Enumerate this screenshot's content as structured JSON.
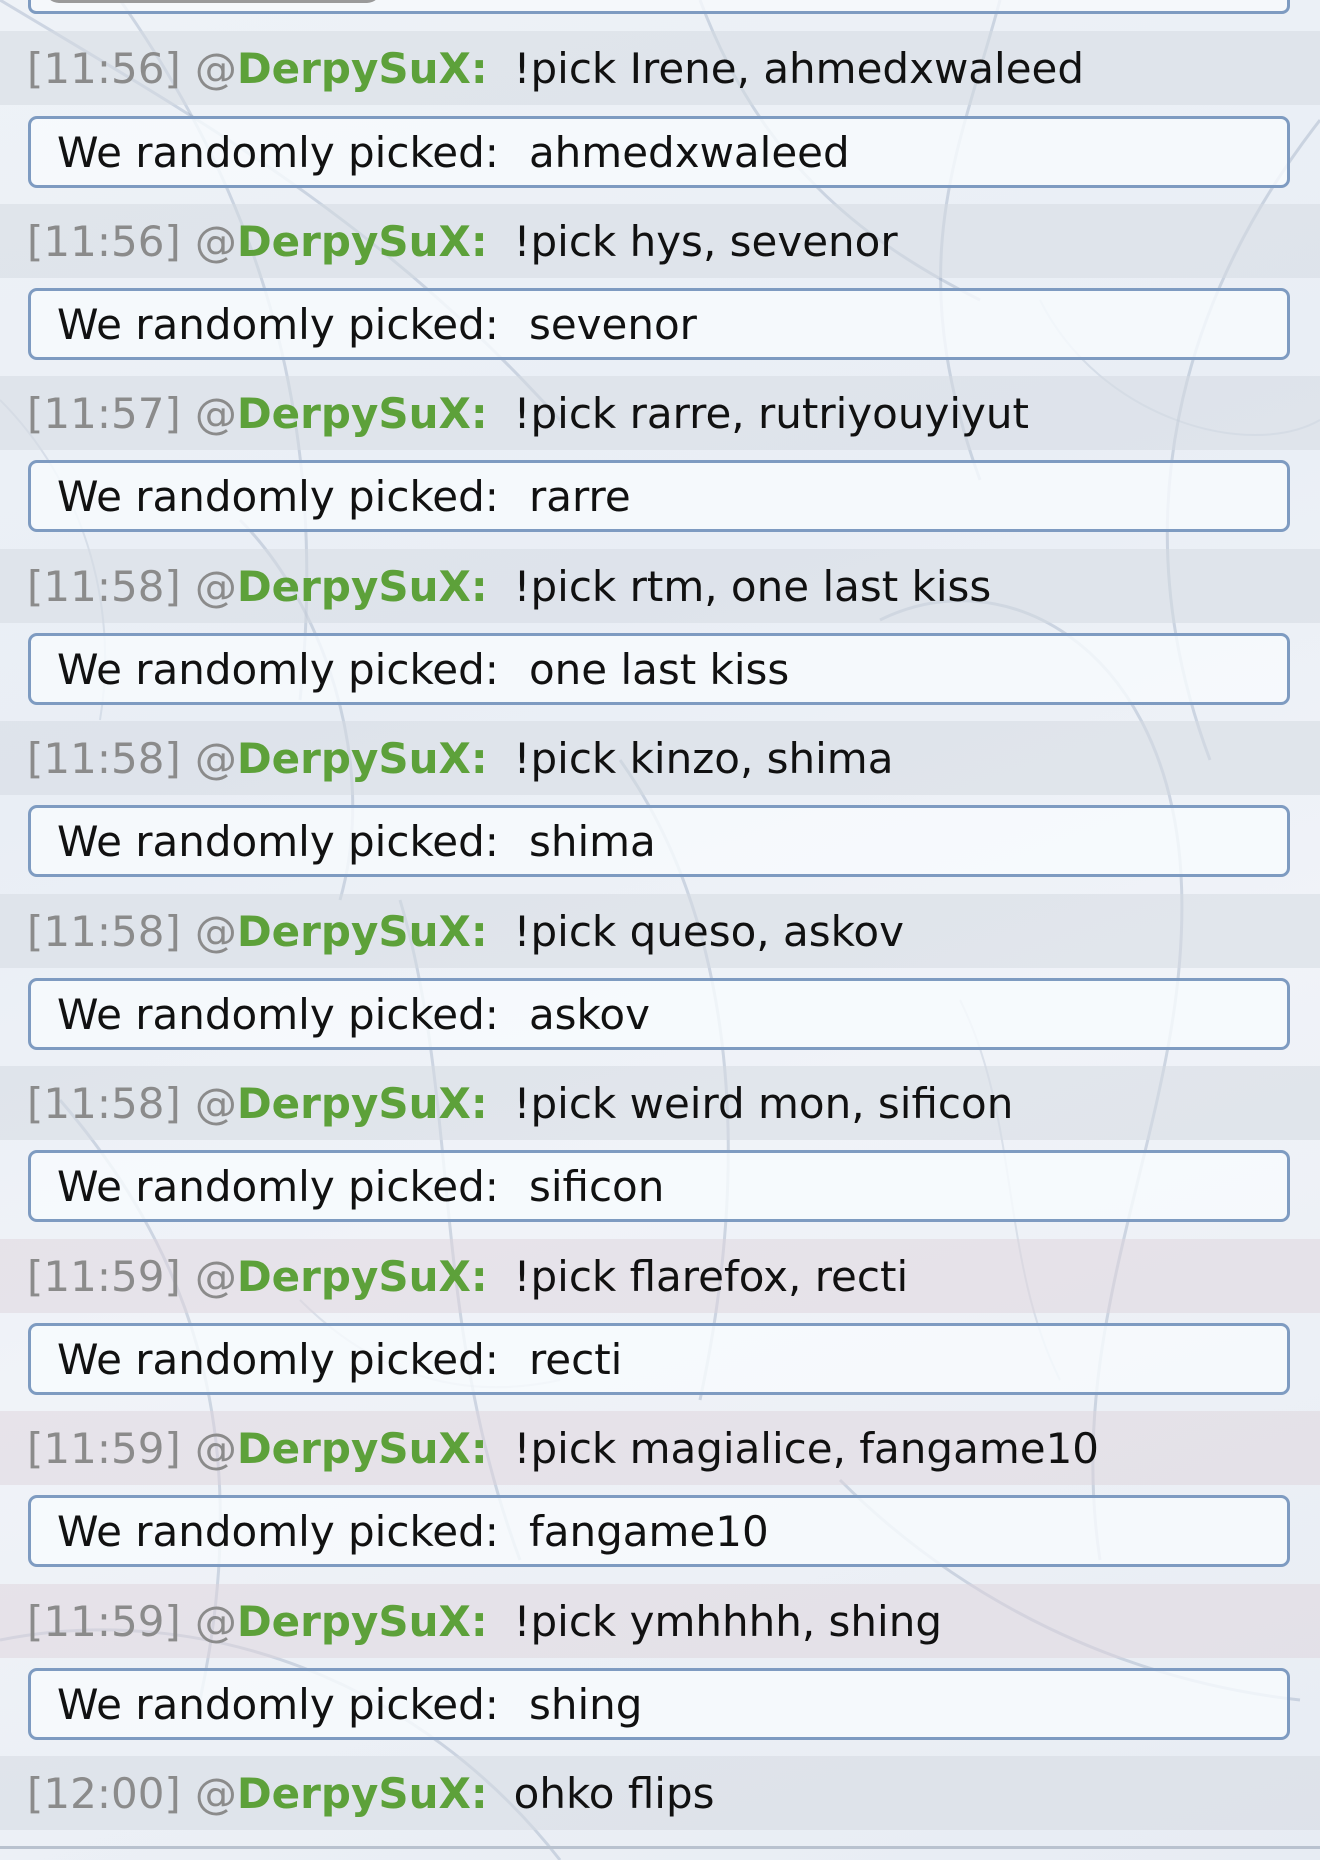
{
  "chat": {
    "username": "DerpySuX:",
    "at_symbol": "@",
    "pick_label": "We randomly picked:",
    "messages": [
      {
        "time": "[11:56]",
        "command": "!pick Irene, ahmedxwaleed",
        "result": "ahmedxwaleed"
      },
      {
        "time": "[11:56]",
        "command": "!pick hys, sevenor",
        "result": "sevenor"
      },
      {
        "time": "[11:57]",
        "command": "!pick rarre, rutriyouyiyut",
        "result": "rarre"
      },
      {
        "time": "[11:58]",
        "command": "!pick rtm, one last kiss",
        "result": "one last kiss"
      },
      {
        "time": "[11:58]",
        "command": "!pick kinzo, shima",
        "result": "shima"
      },
      {
        "time": "[11:58]",
        "command": "!pick queso, askov",
        "result": "askov"
      },
      {
        "time": "[11:58]",
        "command": "!pick weird mon, sificon",
        "result": "sificon"
      },
      {
        "time": "[11:59]",
        "command": "!pick flarefox, recti",
        "result": "recti"
      },
      {
        "time": "[11:59]",
        "command": "!pick magialice, fangame10",
        "result": "fangame10"
      },
      {
        "time": "[11:59]",
        "command": "!pick ymhhhh, shing",
        "result": "shing"
      },
      {
        "time": "[12:00]",
        "command": "ohko flips"
      }
    ]
  }
}
